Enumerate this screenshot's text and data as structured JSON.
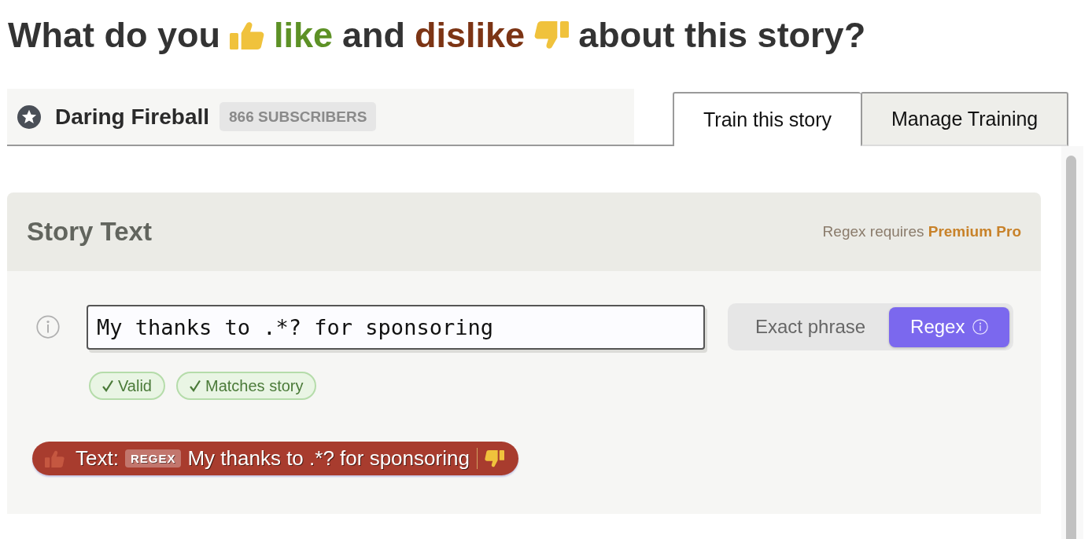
{
  "heading": {
    "parts": [
      {
        "kind": "plain",
        "text": "What do you"
      },
      {
        "kind": "like",
        "text": "like"
      },
      {
        "kind": "plain",
        "text": "and"
      },
      {
        "kind": "dislike",
        "text": "dislike"
      },
      {
        "kind": "plain",
        "text": "about this story?"
      }
    ]
  },
  "feed": {
    "name": "Daring Fireball",
    "subscribers": "866 SUBSCRIBERS"
  },
  "tabs": [
    {
      "label": "Train this story",
      "selected": true
    },
    {
      "label": "Manage Training",
      "selected": false
    }
  ],
  "section": {
    "title": "Story Text",
    "note": "Regex requires **Premium Pro**",
    "input": {
      "value": "My thanks to .*? for sponsoring"
    },
    "modes": [
      {
        "label": "Exact phrase",
        "selected": false,
        "info": false
      },
      {
        "label": "Regex",
        "selected": true,
        "info": true
      }
    ],
    "checks": [
      {
        "label": "Valid",
        "passed": true
      },
      {
        "label": "Matches story",
        "passed": true
      }
    ],
    "classifier": {
      "label": "Text:",
      "badge": "REGEX",
      "value": "My thanks to .*? for sponsoring",
      "liked": false,
      "disliked": true
    }
  }
}
